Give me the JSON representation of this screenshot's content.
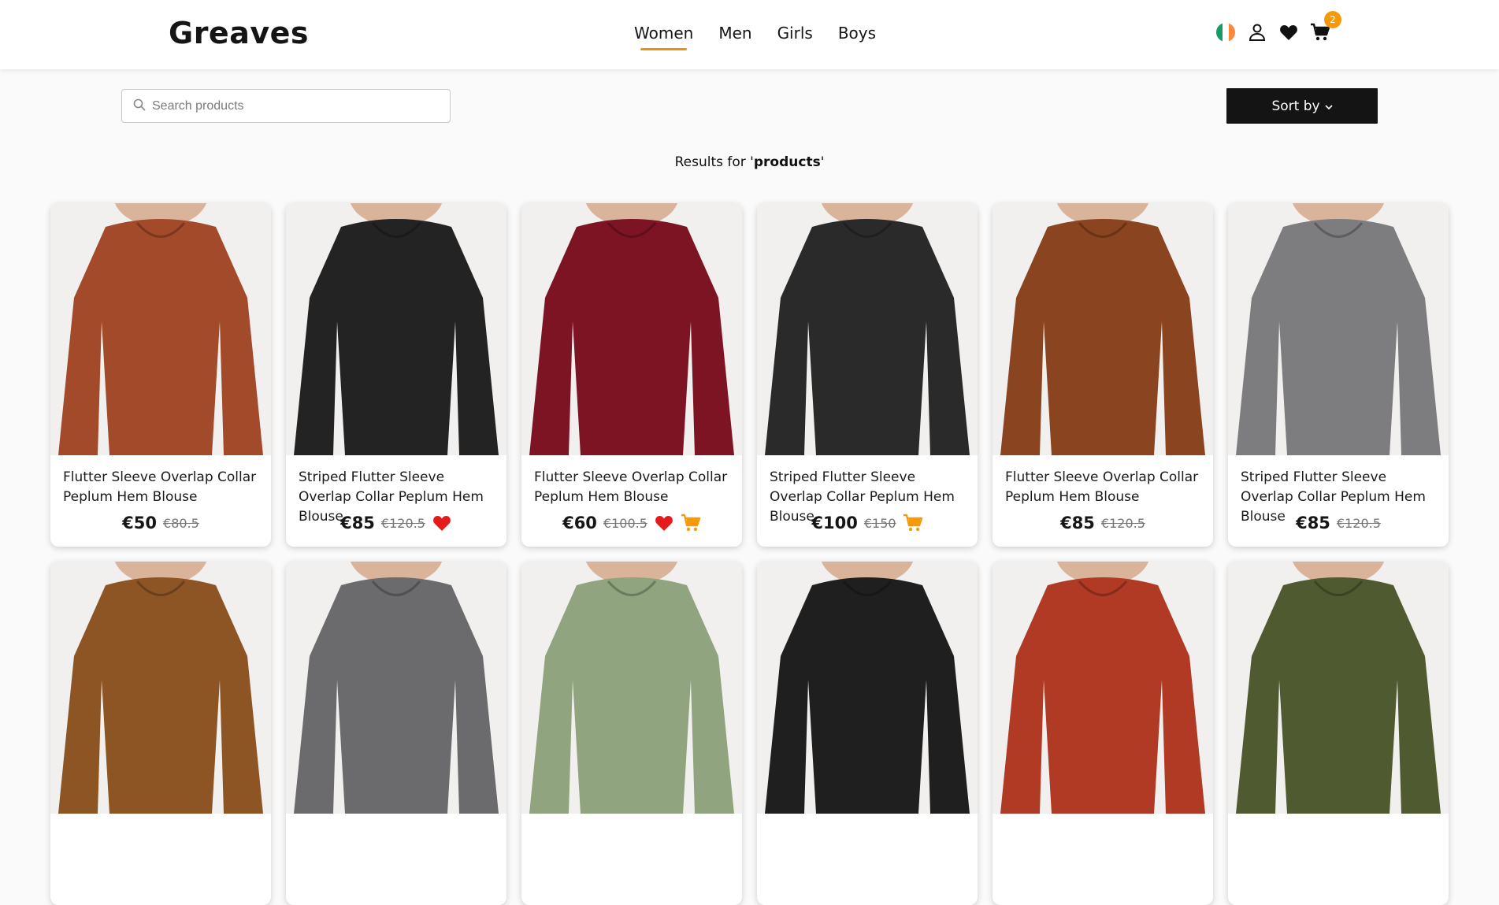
{
  "header": {
    "logo": "Greaves",
    "nav": [
      "Women",
      "Men",
      "Girls",
      "Boys"
    ],
    "active_nav": "Women",
    "cart_count": "2"
  },
  "toolbar": {
    "search_placeholder": "Search products",
    "sort_label": "Sort by"
  },
  "results": {
    "prefix": "Results for '",
    "query": "products",
    "suffix": "'"
  },
  "colors": {
    "accent": "#f59a0b",
    "heart": "#e51b1b",
    "dark": "#141414"
  },
  "products": [
    {
      "title": "Flutter Sleeve Overlap Collar Peplum Hem Blouse",
      "price": "€50",
      "old_price": "€80.5",
      "wishlist": false,
      "cart": false,
      "color": "#a34a2a"
    },
    {
      "title": "Striped Flutter Sleeve Overlap Collar Peplum Hem Blouse",
      "price": "€85",
      "old_price": "€120.5",
      "wishlist": true,
      "cart": false,
      "color": "#232323"
    },
    {
      "title": "Flutter Sleeve Overlap Collar Peplum Hem Blouse",
      "price": "€60",
      "old_price": "€100.5",
      "wishlist": true,
      "cart": true,
      "color": "#7d1424"
    },
    {
      "title": "Striped Flutter Sleeve Overlap Collar Peplum Hem Blouse",
      "price": "€100",
      "old_price": "€150",
      "wishlist": false,
      "cart": true,
      "color": "#2a2a2a"
    },
    {
      "title": "Flutter Sleeve Overlap Collar Peplum Hem Blouse",
      "price": "€85",
      "old_price": "€120.5",
      "wishlist": false,
      "cart": false,
      "color": "#8a4420"
    },
    {
      "title": "Striped Flutter Sleeve Overlap Collar Peplum Hem Blouse",
      "price": "€85",
      "old_price": "€120.5",
      "wishlist": false,
      "cart": false,
      "color": "#7d7d80"
    },
    {
      "title": "",
      "price": "",
      "old_price": "",
      "wishlist": false,
      "cart": false,
      "color": "#8e5524"
    },
    {
      "title": "",
      "price": "",
      "old_price": "",
      "wishlist": false,
      "cart": false,
      "color": "#6b6b6e"
    },
    {
      "title": "",
      "price": "",
      "old_price": "",
      "wishlist": false,
      "cart": false,
      "color": "#8fa47f"
    },
    {
      "title": "",
      "price": "",
      "old_price": "",
      "wishlist": false,
      "cart": false,
      "color": "#1f1f1f"
    },
    {
      "title": "",
      "price": "",
      "old_price": "",
      "wishlist": false,
      "cart": false,
      "color": "#b03a24"
    },
    {
      "title": "",
      "price": "",
      "old_price": "",
      "wishlist": false,
      "cart": false,
      "color": "#4f5a30"
    }
  ]
}
